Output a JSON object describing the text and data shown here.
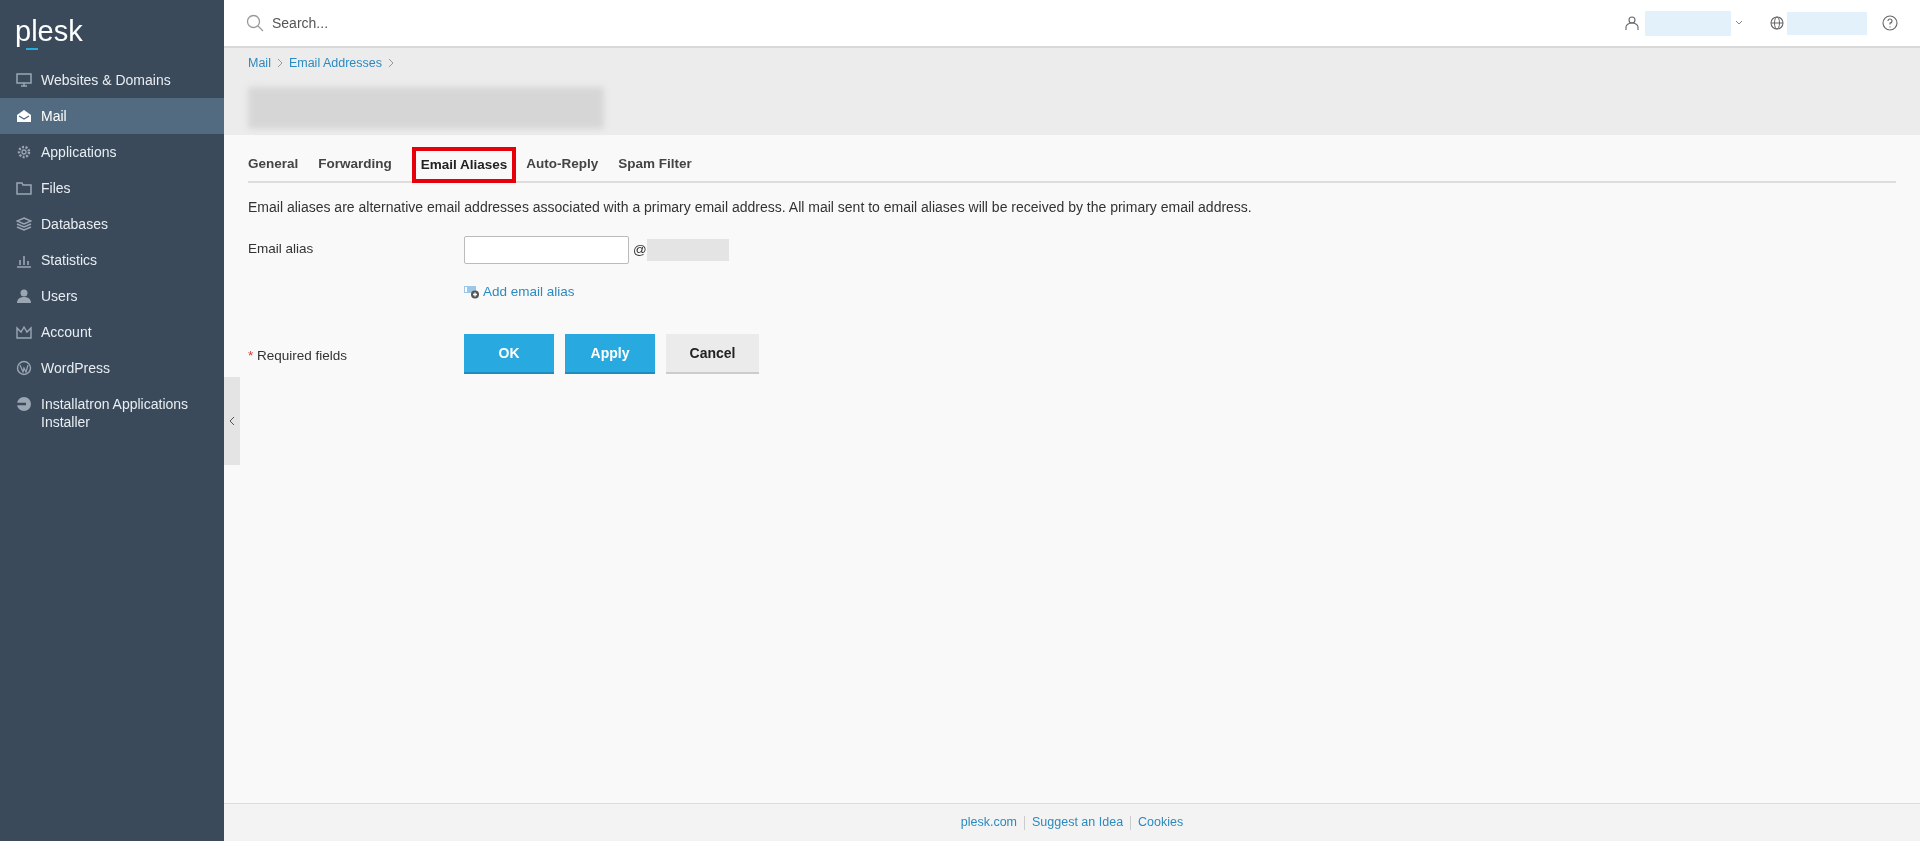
{
  "logo": "plesk",
  "search": {
    "placeholder": "Search..."
  },
  "sidebar": {
    "items": [
      {
        "label": "Websites & Domains",
        "selected": false
      },
      {
        "label": "Mail",
        "selected": true
      },
      {
        "label": "Applications",
        "selected": false
      },
      {
        "label": "Files",
        "selected": false
      },
      {
        "label": "Databases",
        "selected": false
      },
      {
        "label": "Statistics",
        "selected": false
      },
      {
        "label": "Users",
        "selected": false
      },
      {
        "label": "Account",
        "selected": false
      },
      {
        "label": "WordPress",
        "selected": false
      },
      {
        "label": "Installatron Applications Installer",
        "selected": false
      }
    ]
  },
  "breadcrumbs": [
    "Mail",
    "Email Addresses"
  ],
  "tabs": [
    {
      "label": "General",
      "selected": false
    },
    {
      "label": "Forwarding",
      "selected": false
    },
    {
      "label": "Email Aliases",
      "selected": true
    },
    {
      "label": "Auto-Reply",
      "selected": false
    },
    {
      "label": "Spam Filter",
      "selected": false
    }
  ],
  "description": "Email aliases are alternative email addresses associated with a primary email address. All mail sent to email aliases will be received by the primary email address.",
  "form": {
    "alias_label": "Email alias",
    "at_sign": "@",
    "add_link": "Add email alias",
    "required_mark": "*",
    "required_note": "Required fields"
  },
  "buttons": [
    {
      "label": "OK",
      "kind": "primary"
    },
    {
      "label": "Apply",
      "kind": "primary"
    },
    {
      "label": "Cancel",
      "kind": "secondary"
    }
  ],
  "footer": [
    "plesk.com",
    "Suggest an Idea",
    "Cookies"
  ]
}
